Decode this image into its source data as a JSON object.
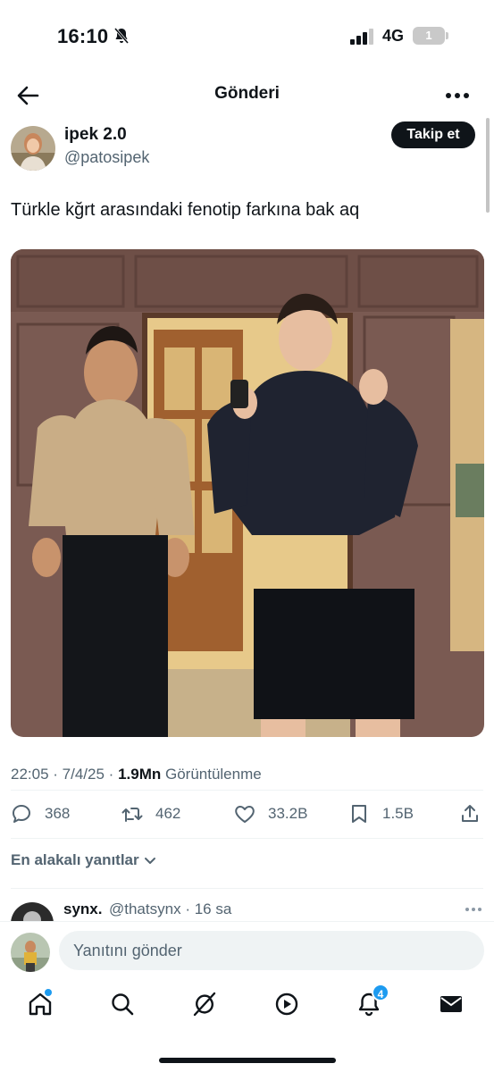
{
  "status_bar": {
    "time": "16:10",
    "network": "4G",
    "battery_level": "1"
  },
  "header": {
    "title": "Gönderi"
  },
  "author": {
    "name": "ipek 2.0",
    "handle": "@patosipek",
    "follow_label": "Takip et"
  },
  "tweet": {
    "text": "Türkle kğrt arasındaki fenotip farkına bak aq",
    "time": "22:05",
    "date": "7/4/25",
    "views": "1.9Mn",
    "views_label": "Görüntülenme"
  },
  "actions": {
    "replies": "368",
    "retweets": "462",
    "likes": "33.2B",
    "bookmarks": "1.5B"
  },
  "replies_section": {
    "sort_label": "En alakalı yanıtlar"
  },
  "reply_preview": {
    "name": "synx.",
    "handle": "@thatsynx",
    "time": "16 sa"
  },
  "composer": {
    "placeholder": "Yanıtını gönder"
  },
  "bottom_nav": {
    "notifications_count": "4"
  },
  "colors": {
    "accent": "#1d9bf0",
    "text_primary": "#0f1419",
    "text_secondary": "#536471"
  }
}
